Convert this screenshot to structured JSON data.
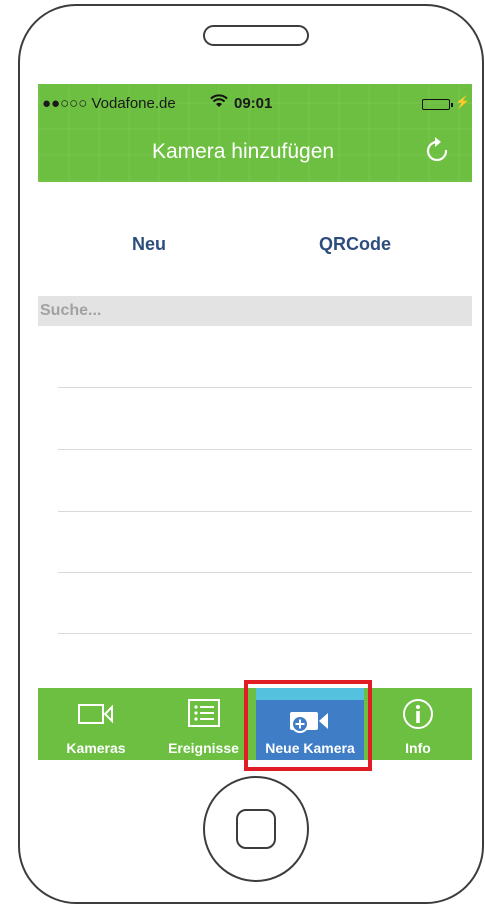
{
  "status_bar": {
    "carrier": "●●○○○ Vodafone.de",
    "time": "09:01"
  },
  "nav": {
    "title": "Kamera hinzufügen",
    "refresh_icon": "refresh-icon"
  },
  "segments": {
    "left": "Neu",
    "right": "QRCode"
  },
  "search": {
    "placeholder": "Suche..."
  },
  "tabs": [
    {
      "label": "Kameras",
      "icon": "video-camera-icon"
    },
    {
      "label": "Ereignisse",
      "icon": "list-icon"
    },
    {
      "label": "Neue Kamera",
      "icon": "add-camera-icon",
      "active": true
    },
    {
      "label": "Info",
      "icon": "info-icon"
    }
  ],
  "colors": {
    "header_green": "#6cbf41",
    "active_tab_blue": "#3f7ec6",
    "active_tab_stripe": "#54c1df",
    "segment_text": "#2c4d7e",
    "highlight_red": "#e01d25"
  }
}
